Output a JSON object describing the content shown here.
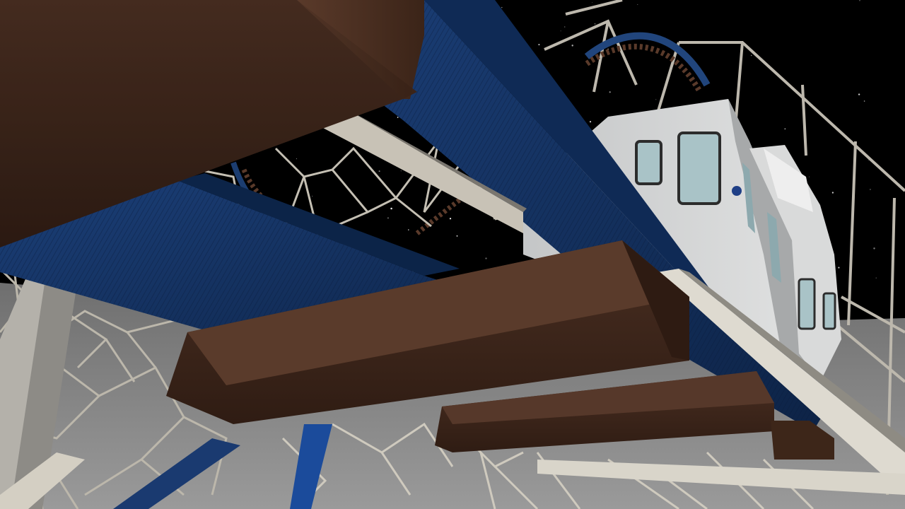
{
  "scene": {
    "colors": {
      "sky": "#000000",
      "ground": "#8c8c8c",
      "track_blue": "#14335f",
      "wood_brown": "#3d261b",
      "support_steel": "#c9c4b8",
      "train_body": "#cfd0d0",
      "train_window": "#a9c3c7"
    },
    "icons": [
      "rollercoaster-track",
      "moon-surface",
      "starfield",
      "coaster-train"
    ]
  }
}
